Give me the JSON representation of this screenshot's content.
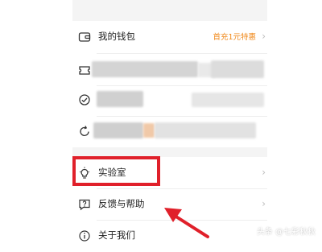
{
  "menu": {
    "wallet": {
      "label": "我的钱包",
      "promo": "首充1元特惠"
    },
    "lab": {
      "label": "实验室"
    },
    "feedback": {
      "label": "反馈与帮助"
    },
    "about": {
      "label": "关于我们"
    }
  },
  "icons": {
    "wallet": "wallet-icon",
    "row2": "coupon-icon",
    "row3": "clock-icon",
    "row4": "refresh-icon",
    "lab": "lightbulb-icon",
    "feedback": "help-bubble-icon",
    "about": "info-icon",
    "chevron": "chevron-right-icon"
  },
  "chevron": "›",
  "colors": {
    "promo": "#f08a1c",
    "highlight": "#e0202a",
    "arrow": "#e0202a"
  },
  "watermark": "头条 @七彩秋秋"
}
